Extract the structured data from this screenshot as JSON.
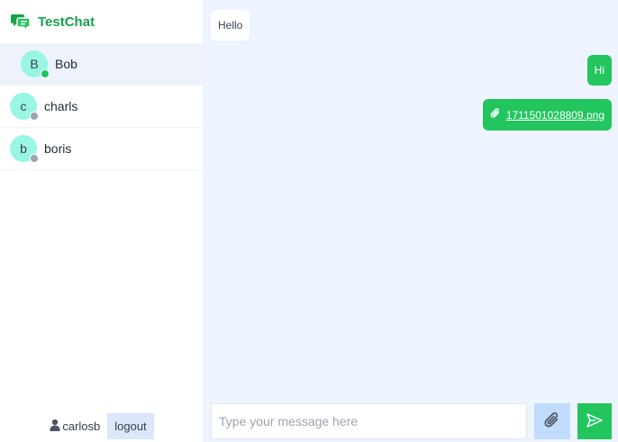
{
  "app": {
    "name": "TestChat",
    "brand_color": "#16a34a"
  },
  "contacts": [
    {
      "initial": "B",
      "name": "Bob",
      "status": "online",
      "status_color": "#22c55e",
      "active": true
    },
    {
      "initial": "c",
      "name": "charls",
      "status": "offline",
      "status_color": "#9ca3af",
      "active": false
    },
    {
      "initial": "b",
      "name": "boris",
      "status": "offline",
      "status_color": "#9ca3af",
      "active": false
    }
  ],
  "current_user": {
    "username": "carlosb",
    "logout_label": "logout"
  },
  "messages": [
    {
      "direction": "incoming",
      "type": "text",
      "text": "Hello"
    },
    {
      "direction": "outgoing",
      "type": "text",
      "text": "Hi"
    },
    {
      "direction": "outgoing",
      "type": "file",
      "text": "1711501028809.png",
      "icon": "paperclip-icon"
    }
  ],
  "composer": {
    "placeholder": "Type your message here",
    "attach_icon": "paperclip-icon",
    "send_icon": "send-icon"
  },
  "colors": {
    "accent": "#22c55e",
    "chat_background": "#eef4fe",
    "attach_button": "#bfdbfe",
    "avatar": "#99f6e4"
  }
}
